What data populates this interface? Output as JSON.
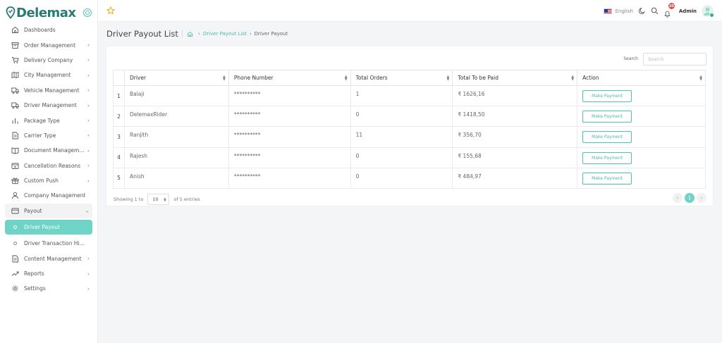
{
  "brand": {
    "name": "Delemax"
  },
  "topbar": {
    "language": "English",
    "notification_count": "20",
    "user_name": "Admin"
  },
  "sidebar": {
    "items": [
      {
        "label": "Dashboards",
        "icon": "home-icon",
        "chevron": false
      },
      {
        "label": "Order Management",
        "icon": "box-icon",
        "chevron": true
      },
      {
        "label": "Delivery Company",
        "icon": "cart-icon",
        "chevron": true
      },
      {
        "label": "City Management",
        "icon": "map-icon",
        "chevron": true
      },
      {
        "label": "Vehicle Management",
        "icon": "truck-icon",
        "chevron": true
      },
      {
        "label": "Driver Management",
        "icon": "truck-icon",
        "chevron": true
      },
      {
        "label": "Package Type",
        "icon": "bar-chart-icon",
        "chevron": true
      },
      {
        "label": "Carrier Type",
        "icon": "document-icon",
        "chevron": true
      },
      {
        "label": "Document Management",
        "icon": "book-icon",
        "chevron": true
      },
      {
        "label": "Cancellation Reasons",
        "icon": "x-square-icon",
        "chevron": true
      },
      {
        "label": "Custom Push",
        "icon": "gift-icon",
        "chevron": true
      },
      {
        "label": "Company Management",
        "icon": "user-icon",
        "chevron": false
      },
      {
        "label": "Payout",
        "icon": "credit-card-icon",
        "chevron": true,
        "open": true
      }
    ],
    "sub_items": [
      {
        "label": "Driver Payout",
        "active": true
      },
      {
        "label": "Driver Transaction History",
        "active": false
      }
    ],
    "items_after": [
      {
        "label": "Content Management",
        "icon": "document-icon",
        "chevron": true
      },
      {
        "label": "Reports",
        "icon": "trend-icon",
        "chevron": true
      },
      {
        "label": "Settings",
        "icon": "gear-icon",
        "chevron": true
      }
    ]
  },
  "page": {
    "title": "Driver Payout List",
    "breadcrumb_link": "Driver Payout List",
    "breadcrumb_current": "Driver Payout"
  },
  "table": {
    "search_label": "Search",
    "search_placeholder": "Search",
    "columns": [
      "Driver",
      "Phone Number",
      "Total Orders",
      "Total To be Paid",
      "Action"
    ],
    "rows": [
      {
        "index": "1",
        "driver": "Balaji",
        "phone": "**********",
        "orders": "1",
        "amount": "₹ 1626,16",
        "action": "Make Payment"
      },
      {
        "index": "2",
        "driver": "DelemaxRider",
        "phone": "**********",
        "orders": "0",
        "amount": "₹ 1418,50",
        "action": "Make Payment"
      },
      {
        "index": "3",
        "driver": "Ranjith",
        "phone": "**********",
        "orders": "11",
        "amount": "₹ 356,70",
        "action": "Make Payment"
      },
      {
        "index": "4",
        "driver": "Rajesh",
        "phone": "**********",
        "orders": "0",
        "amount": "₹ 155,68",
        "action": "Make Payment"
      },
      {
        "index": "5",
        "driver": "Anish",
        "phone": "**********",
        "orders": "0",
        "amount": "₹ 484,97",
        "action": "Make Payment"
      }
    ],
    "showing_prefix": "Showing 1 to",
    "per_page": "10",
    "showing_suffix": "of 5 entries",
    "current_page": "1"
  },
  "colors": {
    "accent": "#6fd3c6",
    "brand": "#2a7a74",
    "badge": "#e64a4a"
  }
}
